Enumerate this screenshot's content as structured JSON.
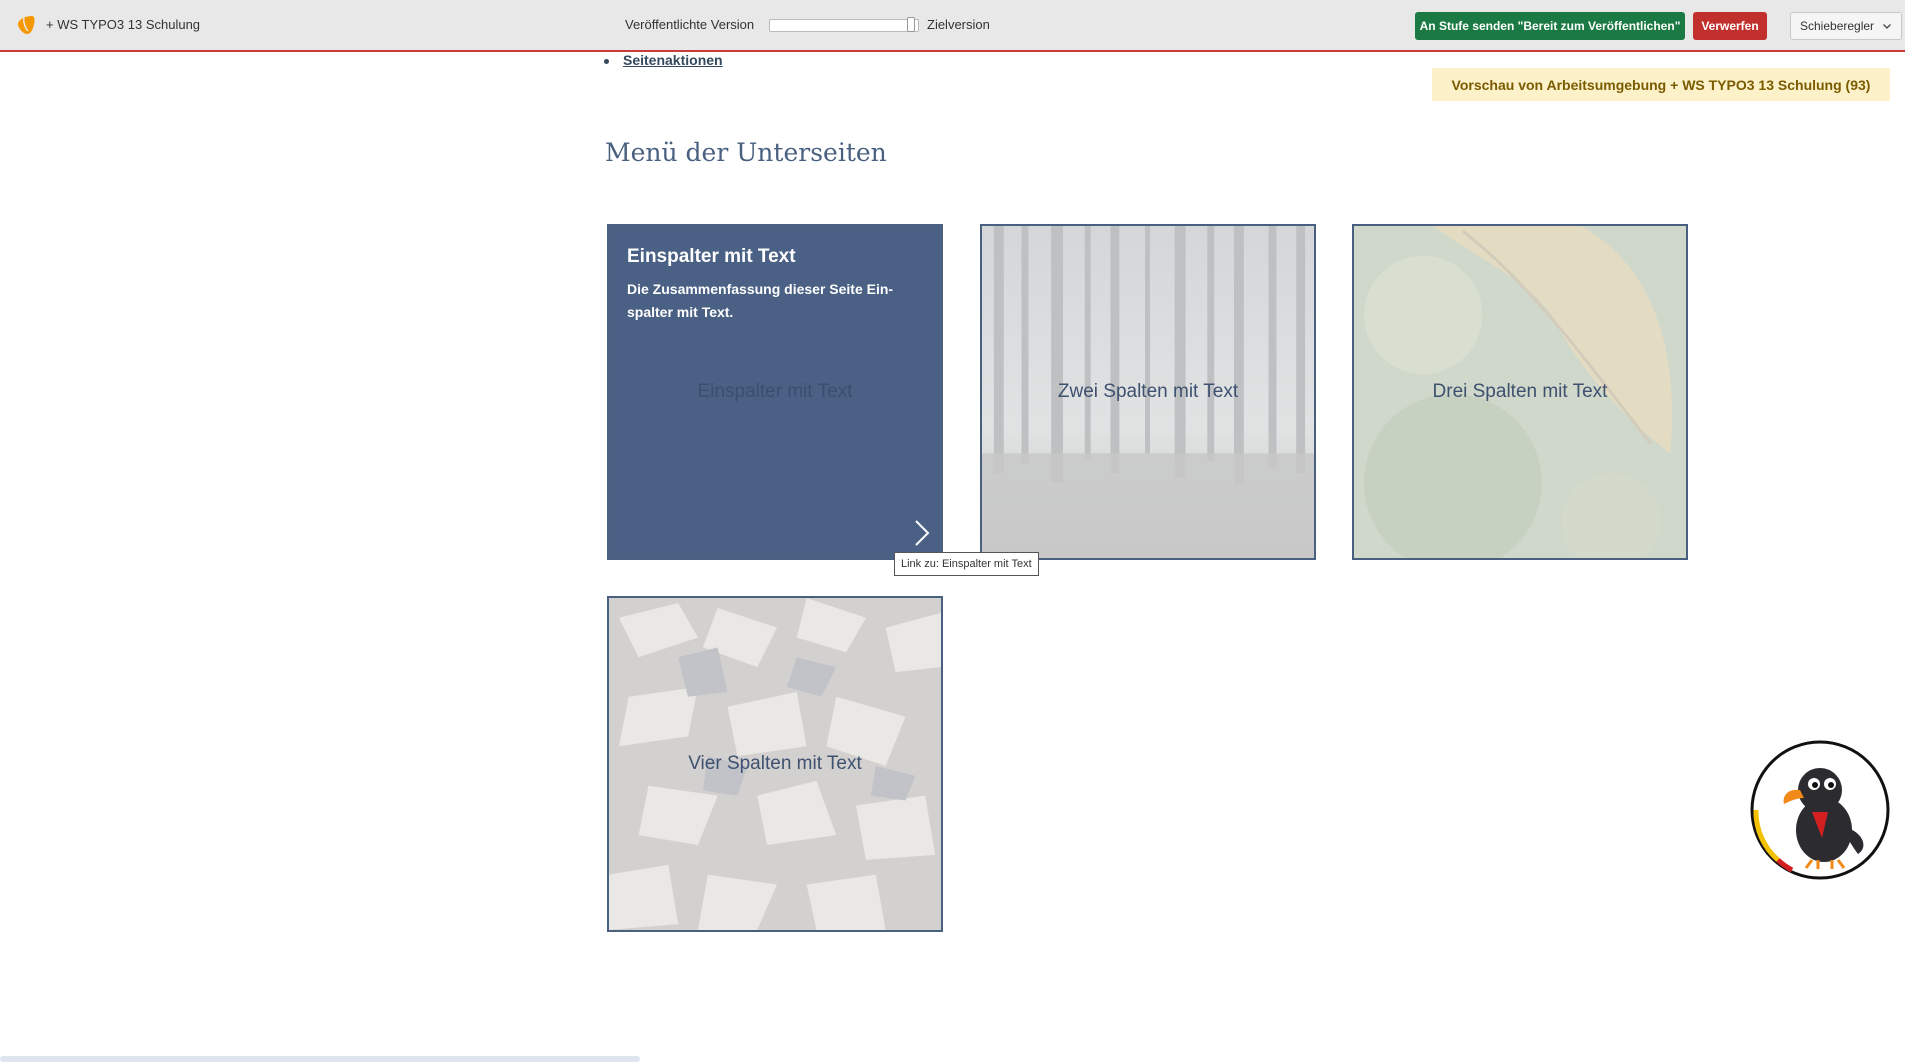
{
  "topbar": {
    "site_name": "+ WS TYPO3 13 Schulung",
    "published_label": "Veröffentlichte Version",
    "target_label": "Zielversion",
    "send_button": "An Stufe senden \"Bereit zum Veröffentlichen\"",
    "discard_button": "Verwerfen",
    "mode_select": "Schieberegler",
    "colors": {
      "send": "#1b7a43",
      "discard": "#c2302d",
      "bar_border": "#c83c3c"
    }
  },
  "page_actions_link": "Seitenaktionen",
  "preview_badge": "Vorschau von Arbeitsumgebung + WS TYPO3 13 Schulung (93)",
  "section_title": "Menü der Unterseiten",
  "cards": [
    {
      "label": "Einspalter mit Text",
      "hover_title": "Einspalter mit Text",
      "hover_text": "Die Zusammenfassung dieser Seite Ein-spalter mit Text.",
      "icon": "chevron-right-icon"
    },
    {
      "label": "Zwei Spalten mit Text"
    },
    {
      "label": "Drei Spalten mit Text"
    },
    {
      "label": "Vier Spalten mit Text"
    }
  ],
  "tooltip": "Link zu: Einspalter mit Text",
  "icons": {
    "logo": "typo3-logo-icon",
    "chevron": "chevron-down-icon",
    "mascot": "raven-mascot-icon"
  }
}
